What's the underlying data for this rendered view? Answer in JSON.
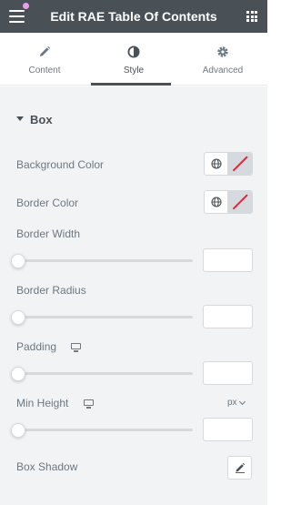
{
  "header": {
    "title": "Edit RAE Table Of Contents",
    "menu_icon": "hamburger-icon",
    "apps_icon": "grid-icon",
    "notification_dot_color": "#e7a0ea",
    "background_color": "#495157"
  },
  "tabs": [
    {
      "label": "Content",
      "icon": "pencil-icon",
      "active": false
    },
    {
      "label": "Style",
      "icon": "half-circle-icon",
      "active": true
    },
    {
      "label": "Advanced",
      "icon": "gear-icon",
      "active": false
    }
  ],
  "section": {
    "title": "Box",
    "expanded": true
  },
  "controls": {
    "background_color": {
      "label": "Background Color",
      "value": "unset"
    },
    "border_color": {
      "label": "Border Color",
      "value": "unset"
    },
    "border_width": {
      "label": "Border Width",
      "value": "",
      "slider_fraction": 0
    },
    "border_radius": {
      "label": "Border Radius",
      "value": "",
      "slider_fraction": 0
    },
    "padding": {
      "label": "Padding",
      "responsive_icon": "desktop-icon",
      "value": "",
      "slider_fraction": 0
    },
    "min_height": {
      "label": "Min Height",
      "responsive_icon": "desktop-icon",
      "unit": "px",
      "value": "",
      "slider_fraction": 0
    },
    "box_shadow": {
      "label": "Box Shadow",
      "edit_icon": "pencil-icon"
    }
  },
  "colors": {
    "panel_background": "#f1f3f5",
    "text": "#6d7882",
    "dark": "#495157",
    "border": "#d5dadf",
    "unset_slash": "#d72b3f"
  }
}
